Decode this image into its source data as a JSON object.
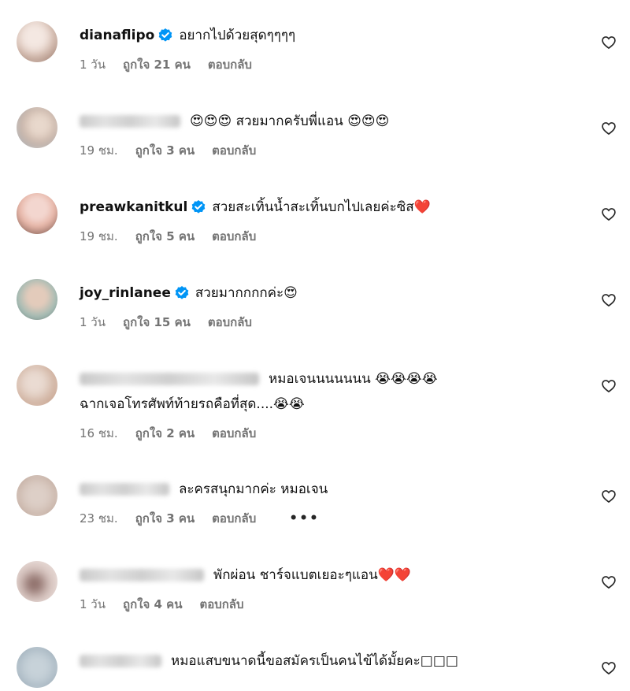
{
  "comments": [
    {
      "username": "dianaflipo",
      "name_blurred": false,
      "verified": true,
      "text": "อยากไปด้วยสุดๆๆๆๆ",
      "time": "1 วัน",
      "likes": "ถูกใจ 21 คน",
      "reply": "ตอบกลับ",
      "avatar_colors": [
        "#d8c0b4",
        "#f4e8e2",
        "#9a7a6c"
      ]
    },
    {
      "username": "",
      "name_blurred": true,
      "verified": false,
      "text": "😍😍😍 สวยมากครับพี่แอน 😍😍😍",
      "time": "19 ชม.",
      "likes": "ถูกใจ 3 คน",
      "reply": "ตอบกลับ",
      "avatar_colors": [
        "#c9b3a6",
        "#a6b7c4",
        "#e8d8cc"
      ]
    },
    {
      "username": "preawkanitkul",
      "name_blurred": false,
      "verified": true,
      "text": "สวยสะเทิ้นน้ำสะเทิ้นบกไปเลยค่ะซิส❤️",
      "time": "19 ชม.",
      "likes": "ถูกใจ 5 คน",
      "reply": "ตอบกลับ",
      "avatar_colors": [
        "#e7b7a9",
        "#f3d6cf",
        "#5b3a32"
      ]
    },
    {
      "username": "joy_rinlanee",
      "name_blurred": false,
      "verified": true,
      "text": "สวยมากกกกค่ะ😍",
      "time": "1 วัน",
      "likes": "ถูกใจ 15 คน",
      "reply": "ตอบกลับ",
      "avatar_colors": [
        "#9fb9b2",
        "#e3cbbb",
        "#4a3a33"
      ]
    },
    {
      "username": "",
      "name_blurred": true,
      "verified": false,
      "text": "หมอเจนนนนนนน 😭😭😭😭",
      "text2": "ฉากเจอโทรศัพท์ท้ายรถคือที่สุด....😭😭",
      "time": "16 ชม.",
      "likes": "ถูกใจ 2 คน",
      "reply": "ตอบกลับ",
      "avatar_colors": [
        "#d3b7a6",
        "#c29883",
        "#eadbd2"
      ]
    },
    {
      "username": "",
      "name_blurred": true,
      "verified": false,
      "text": "ละครสนุกมากค่ะ หมอเจน",
      "time": "23 ชม.",
      "likes": "ถูกใจ 3 คน",
      "reply": "ตอบกลับ",
      "more": "•••",
      "avatar_colors": [
        "#cdb9ae",
        "#ddcfc7",
        "#b09a8f"
      ]
    },
    {
      "username": "",
      "name_blurred": true,
      "verified": false,
      "text": "พักผ่อน ชาร์จแบตเยอะๆแอน❤️❤️",
      "time": "1 วัน",
      "likes": "ถูกใจ 4 คน",
      "reply": "ตอบกลับ",
      "avatar_colors": [
        "#d9c7c2",
        "#8e6f6a",
        "#efe4e0"
      ]
    },
    {
      "username": "",
      "name_blurred": true,
      "verified": false,
      "text": "หมอแสบขนาดนี้ขอสมัครเป็นคนไข้ได้มั้ยคะ□□□",
      "time": "",
      "likes": "",
      "reply": "",
      "avatar_colors": [
        "#a9b8c3",
        "#c7d2d9",
        "#8f9ea9"
      ]
    }
  ],
  "icons": {
    "verified": "verified-badge-icon",
    "like": "heart-outline-icon"
  },
  "colors": {
    "verified_blue": "#0095f6",
    "meta_gray": "#737373"
  }
}
